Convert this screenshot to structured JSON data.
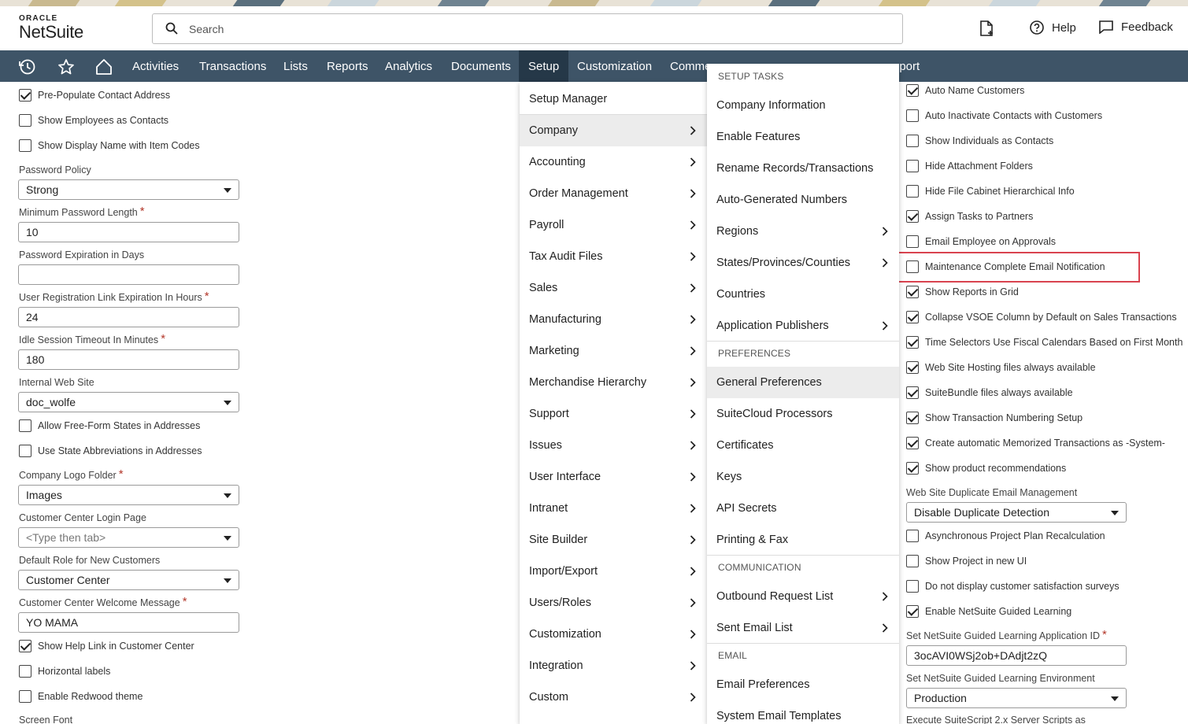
{
  "header": {
    "logo_top": "ORACLE",
    "logo_bottom": "NetSuite",
    "search_placeholder": "Search",
    "help_label": "Help",
    "feedback_label": "Feedback"
  },
  "nav": {
    "items": [
      "Activities",
      "Transactions",
      "Lists",
      "Reports",
      "Analytics",
      "Documents",
      "Setup",
      "Customization",
      "Comme",
      "pport"
    ],
    "active": "Setup"
  },
  "left_form": {
    "checkboxes_top": [
      {
        "label": "Pre-Populate Contact Address",
        "checked": true
      },
      {
        "label": "Show Employees as Contacts",
        "checked": false
      },
      {
        "label": "Show Display Name with Item Codes",
        "checked": false
      }
    ],
    "fields": [
      {
        "label": "Password Policy",
        "value": "Strong",
        "type": "select",
        "required": false
      },
      {
        "label": "Minimum Password Length",
        "value": "10",
        "type": "text",
        "required": true
      },
      {
        "label": "Password Expiration in Days",
        "value": "",
        "type": "text",
        "required": false
      },
      {
        "label": "User Registration Link Expiration In Hours",
        "value": "24",
        "type": "text",
        "required": true
      },
      {
        "label": "Idle Session Timeout In Minutes",
        "value": "180",
        "type": "text",
        "required": true
      },
      {
        "label": "Internal Web Site",
        "value": "doc_wolfe",
        "type": "select",
        "required": false
      }
    ],
    "checkboxes_mid": [
      {
        "label": "Allow Free-Form States in Addresses",
        "checked": false
      },
      {
        "label": "Use State Abbreviations in Addresses",
        "checked": false
      }
    ],
    "fields2": [
      {
        "label": "Company Logo Folder",
        "value": "Images",
        "type": "select",
        "required": true
      },
      {
        "label": "Customer Center Login Page",
        "value": "<Type then tab>",
        "type": "select",
        "required": false
      },
      {
        "label": "Default Role for New Customers",
        "value": "Customer Center",
        "type": "select",
        "required": false
      },
      {
        "label": "Customer Center Welcome Message",
        "value": "YO MAMA",
        "type": "text",
        "required": true
      }
    ],
    "checkboxes_bottom": [
      {
        "label": "Show Help Link in Customer Center",
        "checked": true
      },
      {
        "label": "Horizontal labels",
        "checked": false
      },
      {
        "label": "Enable Redwood theme",
        "checked": false
      }
    ],
    "trailing_label": "Screen Font"
  },
  "menu_setup": {
    "items": [
      {
        "label": "Setup Manager",
        "submenu": false
      },
      {
        "label": "Company",
        "submenu": true
      },
      {
        "label": "Accounting",
        "submenu": true
      },
      {
        "label": "Order Management",
        "submenu": true
      },
      {
        "label": "Payroll",
        "submenu": true
      },
      {
        "label": "Tax Audit Files",
        "submenu": true
      },
      {
        "label": "Sales",
        "submenu": true
      },
      {
        "label": "Manufacturing",
        "submenu": true
      },
      {
        "label": "Marketing",
        "submenu": true
      },
      {
        "label": "Merchandise Hierarchy",
        "submenu": true
      },
      {
        "label": "Support",
        "submenu": true
      },
      {
        "label": "Issues",
        "submenu": true
      },
      {
        "label": "User Interface",
        "submenu": true
      },
      {
        "label": "Intranet",
        "submenu": true
      },
      {
        "label": "Site Builder",
        "submenu": true
      },
      {
        "label": "Import/Export",
        "submenu": true
      },
      {
        "label": "Users/Roles",
        "submenu": true
      },
      {
        "label": "Customization",
        "submenu": true
      },
      {
        "label": "Integration",
        "submenu": true
      },
      {
        "label": "Custom",
        "submenu": true
      }
    ],
    "highlighted": "Company"
  },
  "menu_company": {
    "sections": {
      "setup_tasks": "SETUP TASKS",
      "preferences": "PREFERENCES",
      "communication": "COMMUNICATION",
      "email": "EMAIL"
    },
    "setup_tasks": [
      {
        "label": "Company Information",
        "submenu": false
      },
      {
        "label": "Enable Features",
        "submenu": false
      },
      {
        "label": "Rename Records/Transactions",
        "submenu": false
      },
      {
        "label": "Auto-Generated Numbers",
        "submenu": false
      },
      {
        "label": "Regions",
        "submenu": true
      },
      {
        "label": "States/Provinces/Counties",
        "submenu": true
      },
      {
        "label": "Countries",
        "submenu": false
      },
      {
        "label": "Application Publishers",
        "submenu": true
      }
    ],
    "preferences": [
      {
        "label": "General Preferences",
        "submenu": false
      },
      {
        "label": "SuiteCloud Processors",
        "submenu": false
      },
      {
        "label": "Certificates",
        "submenu": false
      },
      {
        "label": "Keys",
        "submenu": false
      },
      {
        "label": "API Secrets",
        "submenu": false
      },
      {
        "label": "Printing & Fax",
        "submenu": false
      }
    ],
    "communication": [
      {
        "label": "Outbound Request List",
        "submenu": true
      },
      {
        "label": "Sent Email List",
        "submenu": true
      }
    ],
    "email": [
      {
        "label": "Email Preferences",
        "submenu": false
      },
      {
        "label": "System Email Templates",
        "submenu": false
      }
    ],
    "highlighted": "General Preferences"
  },
  "right_form": {
    "checkboxes": [
      {
        "label": "Auto Name Customers",
        "checked": true
      },
      {
        "label": "Auto Inactivate Contacts with Customers",
        "checked": false
      },
      {
        "label": "Show Individuals as Contacts",
        "checked": false
      },
      {
        "label": "Hide Attachment Folders",
        "checked": false
      },
      {
        "label": "Hide File Cabinet Hierarchical Info",
        "checked": false
      },
      {
        "label": "Assign Tasks to Partners",
        "checked": true
      },
      {
        "label": "Email Employee on Approvals",
        "checked": false
      },
      {
        "label": "Maintenance Complete Email Notification",
        "checked": false
      },
      {
        "label": "Show Reports in Grid",
        "checked": true
      },
      {
        "label": "Collapse VSOE Column by Default on Sales Transactions",
        "checked": true
      },
      {
        "label": "Time Selectors Use Fiscal Calendars Based on First Month",
        "checked": true
      },
      {
        "label": "Web Site Hosting files always available",
        "checked": true
      },
      {
        "label": "SuiteBundle files always available",
        "checked": true
      },
      {
        "label": "Show Transaction Numbering Setup",
        "checked": true
      },
      {
        "label": "Create automatic Memorized Transactions as -System-",
        "checked": true
      },
      {
        "label": "Show product recommendations",
        "checked": true
      }
    ],
    "dup_label": "Web Site Duplicate Email Management",
    "dup_value": "Disable Duplicate Detection",
    "checkboxes2": [
      {
        "label": "Asynchronous Project Plan Recalculation",
        "checked": false
      },
      {
        "label": "Show Project in new UI",
        "checked": false
      },
      {
        "label": "Do not display customer satisfaction surveys",
        "checked": false
      },
      {
        "label": "Enable NetSuite Guided Learning",
        "checked": true
      }
    ],
    "gl_app_label": "Set NetSuite Guided Learning Application ID",
    "gl_app_value": "3ocAVI0WSj2ob+DAdjt2zQ",
    "gl_env_label": "Set NetSuite Guided Learning Environment",
    "gl_env_value": "Production",
    "trailing_label": "Execute SuiteScript 2.x Server Scripts as"
  },
  "colors": {
    "nav_bg": "#3e5467",
    "nav_active": "#253848",
    "highlight_box": "#d9434f",
    "required_star": "#b3372a"
  }
}
